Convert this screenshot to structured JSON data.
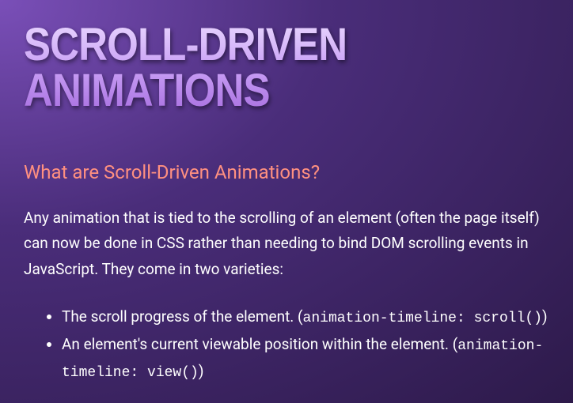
{
  "title": "SCROLL-DRIVEN ANIMATIONS",
  "subheading": "What are Scroll-Driven Animations?",
  "intro": "Any animation that is tied to the scrolling of an element (often the page itself) can now be done in CSS rather than needing to bind DOM scrolling events in JavaScript. They come in two varieties:",
  "bullets": [
    {
      "text": "The scroll progress of the element. (",
      "code": "animation-timeline: scroll()",
      "after": ")"
    },
    {
      "text": "An element's current viewable position within the element. (",
      "code": "animation-timeline: view()",
      "after": ")"
    }
  ]
}
